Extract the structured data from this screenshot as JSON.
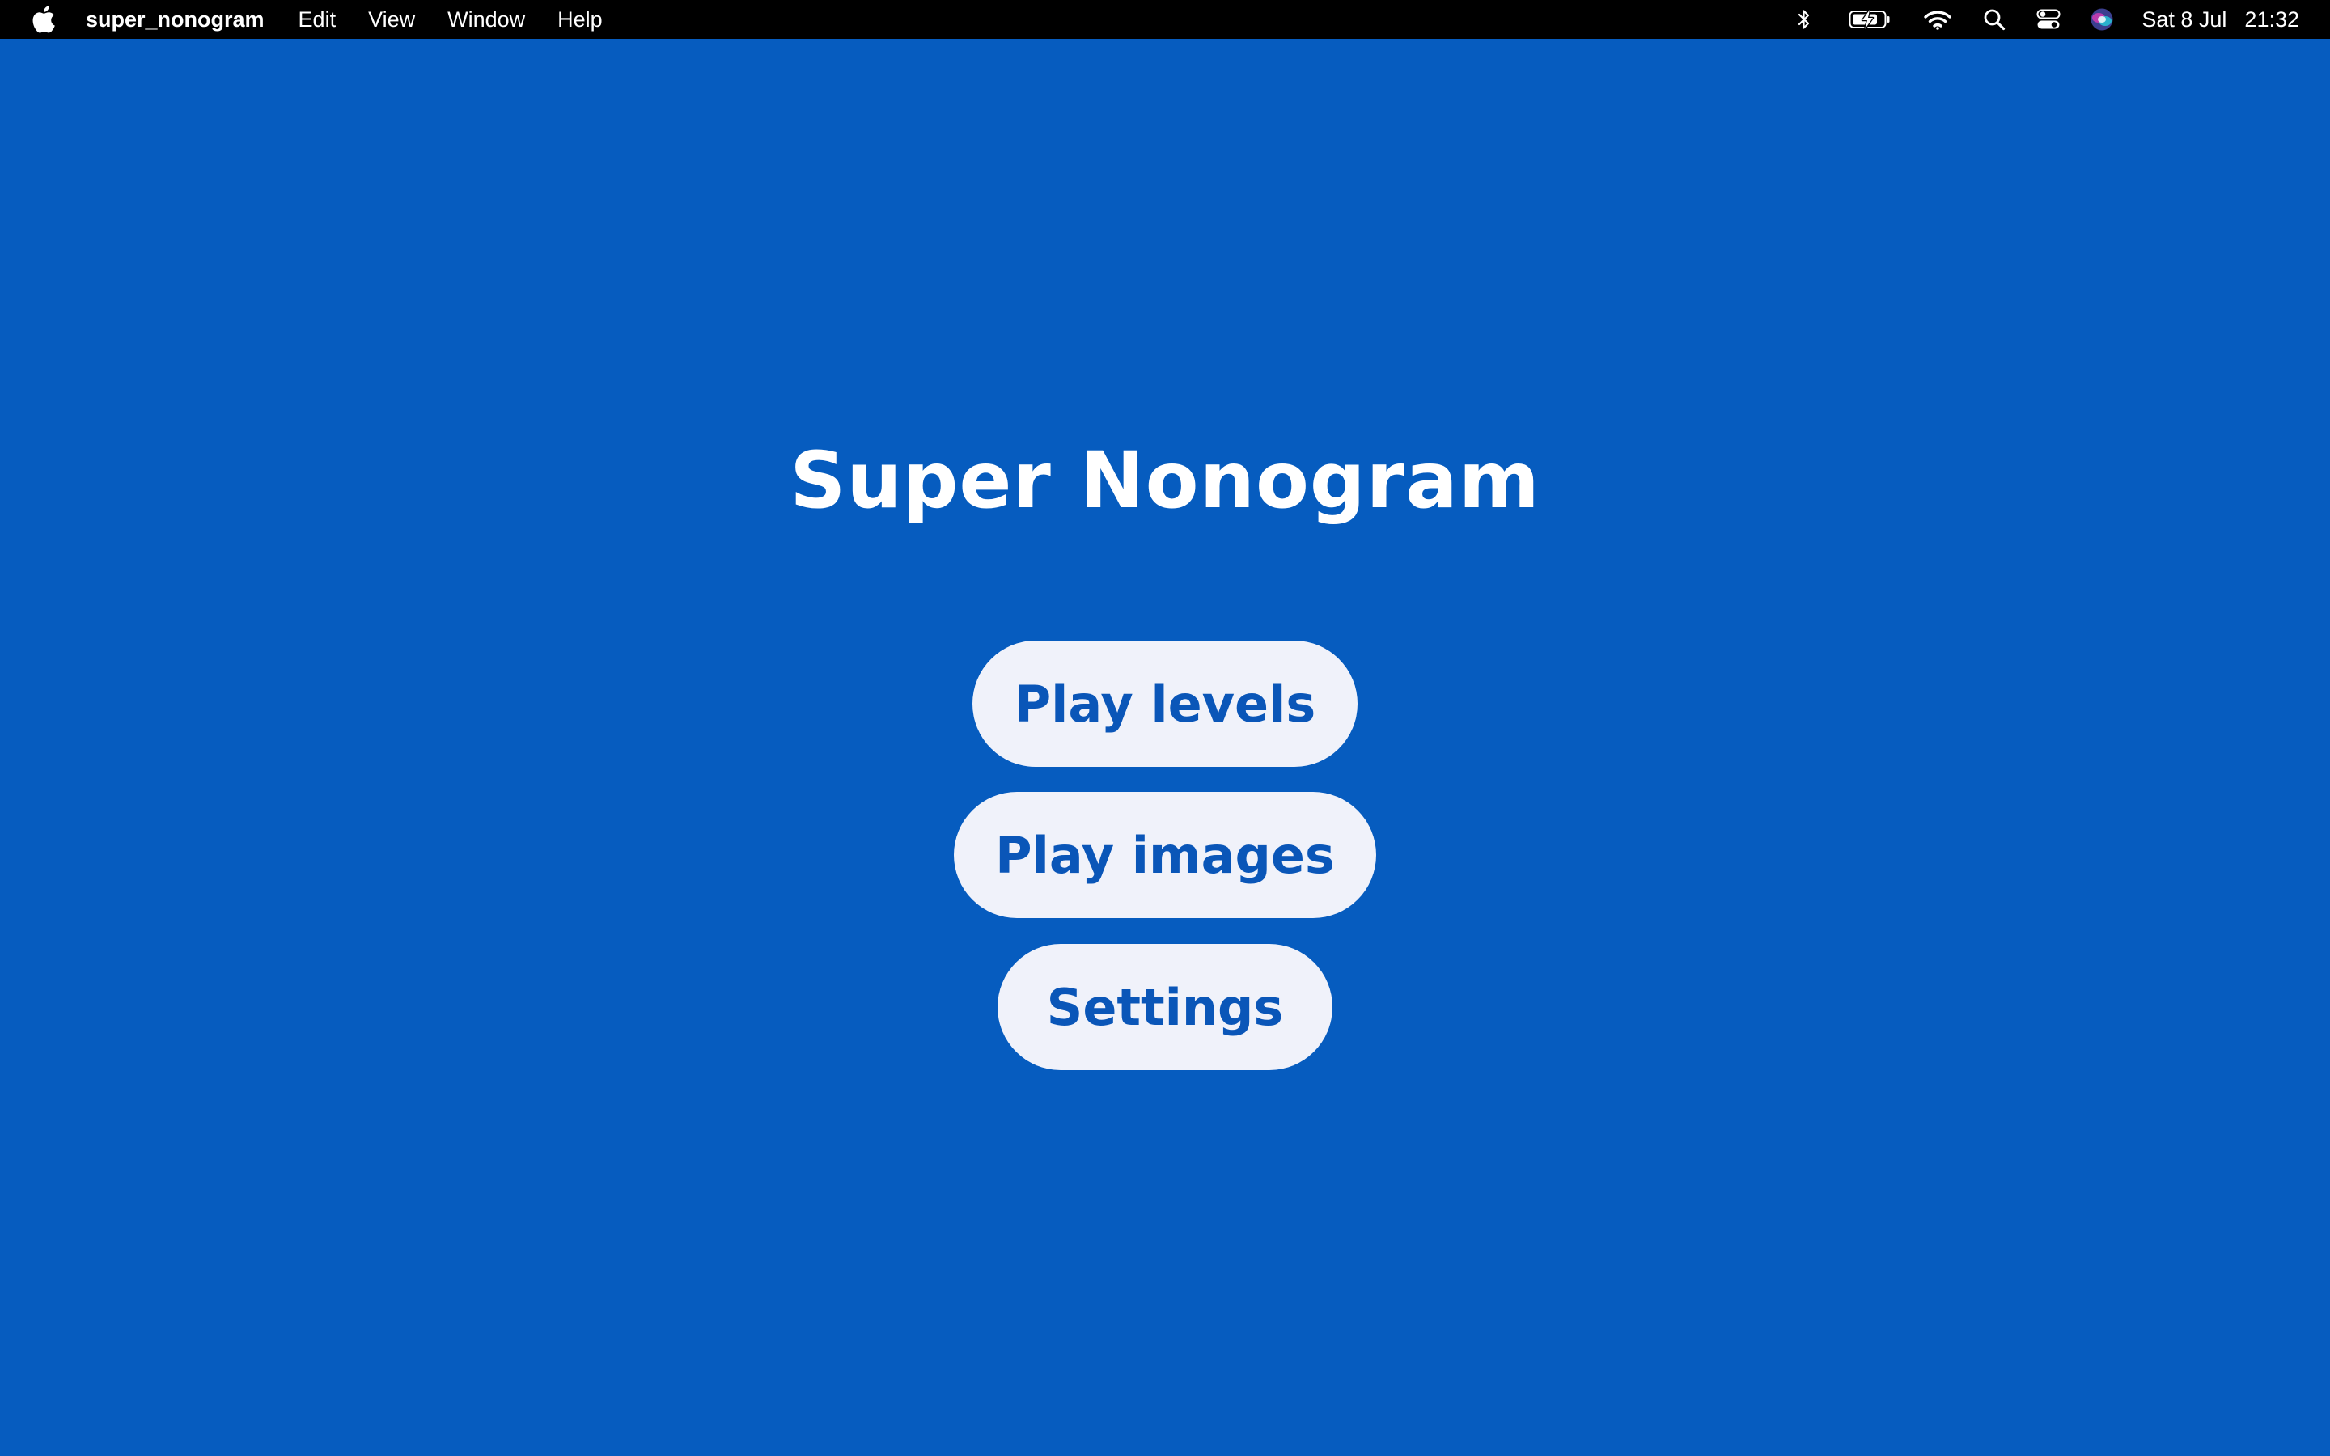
{
  "menubar": {
    "apple_icon": "apple-logo-icon",
    "app_name": "super_nonogram",
    "items": [
      "Edit",
      "View",
      "Window",
      "Help"
    ],
    "status_icons": [
      "bluetooth-icon",
      "battery-charging-icon",
      "wifi-icon",
      "search-icon",
      "control-center-icon",
      "siri-icon"
    ],
    "date": "Sat 8 Jul",
    "time": "21:32"
  },
  "app": {
    "title": "Super Nonogram",
    "buttons": {
      "play_levels": "Play levels",
      "play_images": "Play images",
      "settings": "Settings"
    }
  },
  "colors": {
    "background": "#065cbf",
    "button_background": "#f0f2fa",
    "button_text": "#0a56b8",
    "title_text": "#ffffff",
    "menubar_background": "#000000"
  }
}
